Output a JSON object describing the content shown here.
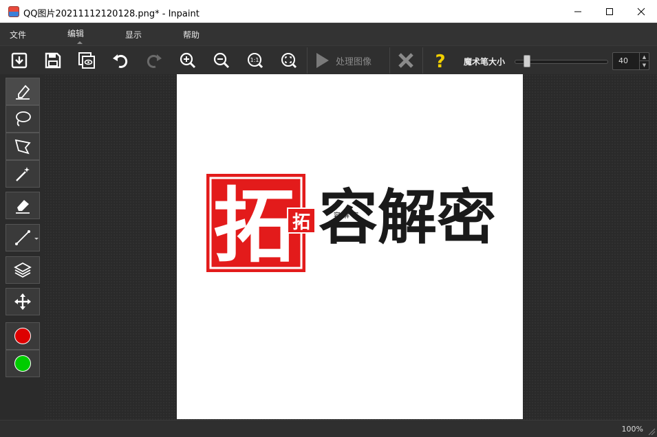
{
  "window": {
    "title": "QQ图片20211112120128.png* - Inpaint",
    "app_icon": "picture-icon"
  },
  "menu": {
    "items": [
      {
        "label": "文件"
      },
      {
        "label": "编辑"
      },
      {
        "label": "显示"
      },
      {
        "label": "帮助"
      }
    ]
  },
  "toolbar": {
    "process_label": "处理图像",
    "brush_size_label": "魔术笔大小",
    "brush_size_value": "40",
    "brush_size_level": 0.1,
    "icons": [
      "open-icon",
      "save-icon",
      "preview-icon",
      "undo-icon",
      "redo-icon",
      "zoom-in-icon",
      "zoom-out-icon",
      "actual-size-icon",
      "fit-window-icon",
      "play-icon",
      "close-icon",
      "help-icon"
    ]
  },
  "sidebar": {
    "tools": [
      "marker-icon",
      "lasso-icon",
      "polygon-lasso-icon",
      "magic-wand-icon",
      "eraser-icon",
      "line-icon",
      "layers-icon",
      "move-icon"
    ],
    "colors": [
      "#dd0000",
      "#00cc00"
    ]
  },
  "image": {
    "seal_char": "拓",
    "small_seal_char": "拓",
    "brand_text": "容解密",
    "small_text": "容 解 密"
  },
  "status": {
    "zoom": "100%"
  },
  "colors": {
    "accent_yellow": "#f2d000",
    "seal_red": "#e31b1b"
  }
}
